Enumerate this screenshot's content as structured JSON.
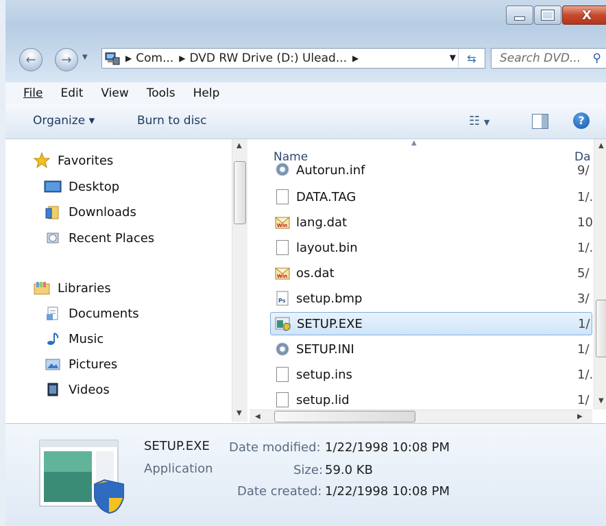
{
  "address": {
    "segments": [
      "Com...",
      "DVD RW Drive (D:) Ulead..."
    ]
  },
  "search": {
    "placeholder": "Search DVD..."
  },
  "menu": {
    "file": "File",
    "edit": "Edit",
    "view": "View",
    "tools": "Tools",
    "help": "Help"
  },
  "toolbar": {
    "organize": "Organize ▾",
    "burn": "Burn to disc"
  },
  "nav": {
    "favorites": "Favorites",
    "desktop": "Desktop",
    "downloads": "Downloads",
    "recent": "Recent Places",
    "libraries": "Libraries",
    "documents": "Documents",
    "music": "Music",
    "pictures": "Pictures",
    "videos": "Videos"
  },
  "columns": {
    "name": "Name",
    "date": "Da"
  },
  "files": [
    {
      "name": "Autorun.inf",
      "date": "9/",
      "icon": "settings-file-icon"
    },
    {
      "name": "DATA.TAG",
      "date": "1/.",
      "icon": "blank-file-icon"
    },
    {
      "name": "lang.dat",
      "date": "10",
      "icon": "winmail-file-icon"
    },
    {
      "name": "layout.bin",
      "date": "1/.",
      "icon": "blank-file-icon"
    },
    {
      "name": "os.dat",
      "date": "5/",
      "icon": "winmail-file-icon"
    },
    {
      "name": "setup.bmp",
      "date": "3/",
      "icon": "photoshop-file-icon"
    },
    {
      "name": "SETUP.EXE",
      "date": "1/",
      "icon": "application-icon"
    },
    {
      "name": "SETUP.INI",
      "date": "1/",
      "icon": "settings-file-icon"
    },
    {
      "name": "setup.ins",
      "date": "1/.",
      "icon": "blank-file-icon"
    },
    {
      "name": "setup.lid",
      "date": "1/",
      "icon": "blank-file-icon"
    }
  ],
  "details": {
    "filename": "SETUP.EXE",
    "type": "Application",
    "modified_label": "Date modified:",
    "modified": "1/22/1998 10:08 PM",
    "size_label": "Size:",
    "size": "59.0 KB",
    "created_label": "Date created:",
    "created": "1/22/1998 10:08 PM"
  }
}
